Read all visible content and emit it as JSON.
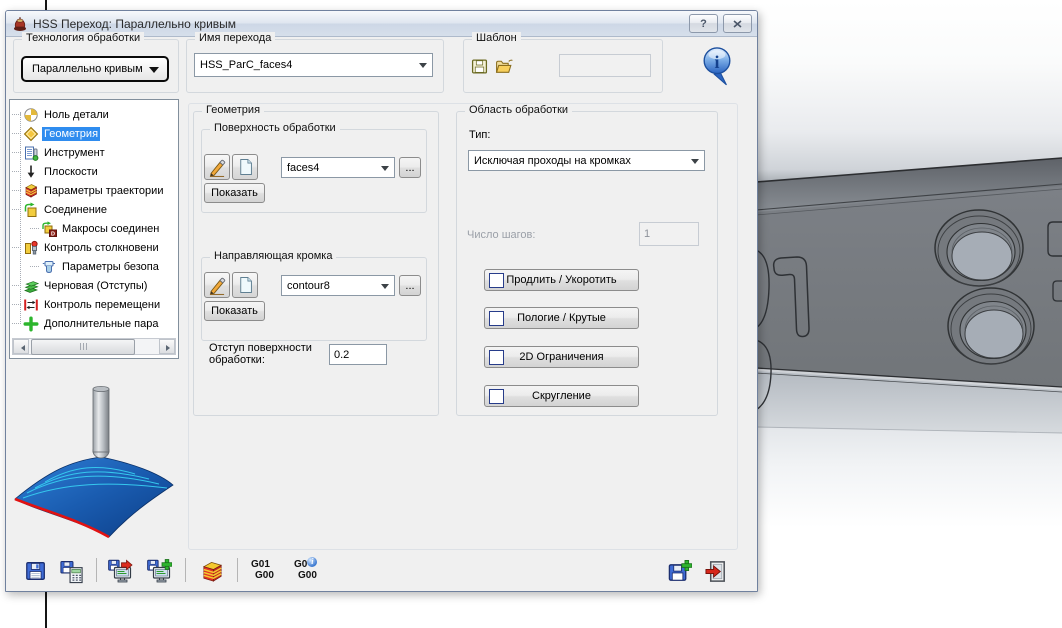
{
  "window": {
    "title": "HSS Переход: Параллельно кривым",
    "help": "?"
  },
  "header": {
    "technology_group": "Технология обработки",
    "technology_value": "Параллельно кривым",
    "name_group": "Имя перехода",
    "name_value": "HSS_ParC_faces4",
    "template_group": "Шаблон",
    "template_value": ""
  },
  "tree": {
    "items": [
      {
        "label": "Ноль детали"
      },
      {
        "label": "Геометрия",
        "selected": true
      },
      {
        "label": "Инструмент"
      },
      {
        "label": "Плоскости"
      },
      {
        "label": "Параметры траектории"
      },
      {
        "label": "Соединение"
      },
      {
        "label": "Макросы соединен",
        "child": true
      },
      {
        "label": "Контроль столкновени"
      },
      {
        "label": "Параметры безопа",
        "child": true
      },
      {
        "label": "Черновая (Отступы)"
      },
      {
        "label": "Контроль перемещени"
      },
      {
        "label": "Дополнительные пара"
      }
    ]
  },
  "geometry": {
    "group": "Геометрия",
    "surface_group": "Поверхность обработки",
    "surface_value": "faces4",
    "edge_group": "Направляющая кромка",
    "edge_value": "contour8",
    "show": "Показать",
    "more": "...",
    "offset_label": "Отступ поверхности обработки:",
    "offset_value": "0.2"
  },
  "area": {
    "group": "Область обработки",
    "type_label": "Тип:",
    "type_value": "Исключая проходы на кромках",
    "steps_label": "Число шагов:",
    "steps_value": "1",
    "buttons": [
      "Продлить / Укоротить",
      "Пологие / Крутые",
      "2D Ограничения",
      "Скругление"
    ]
  },
  "toolbar": {
    "gcode1_line1": "G01",
    "gcode1_line2": "G00",
    "gcode2_line1": "G0",
    "gcode2_line2": "G00",
    "gcode2_badge": "i"
  },
  "colors": {
    "selection": "#2f8cef",
    "surface_blue": "#1a5cb0",
    "edge_red": "#e11212",
    "info_blue": "#2a63c0"
  }
}
